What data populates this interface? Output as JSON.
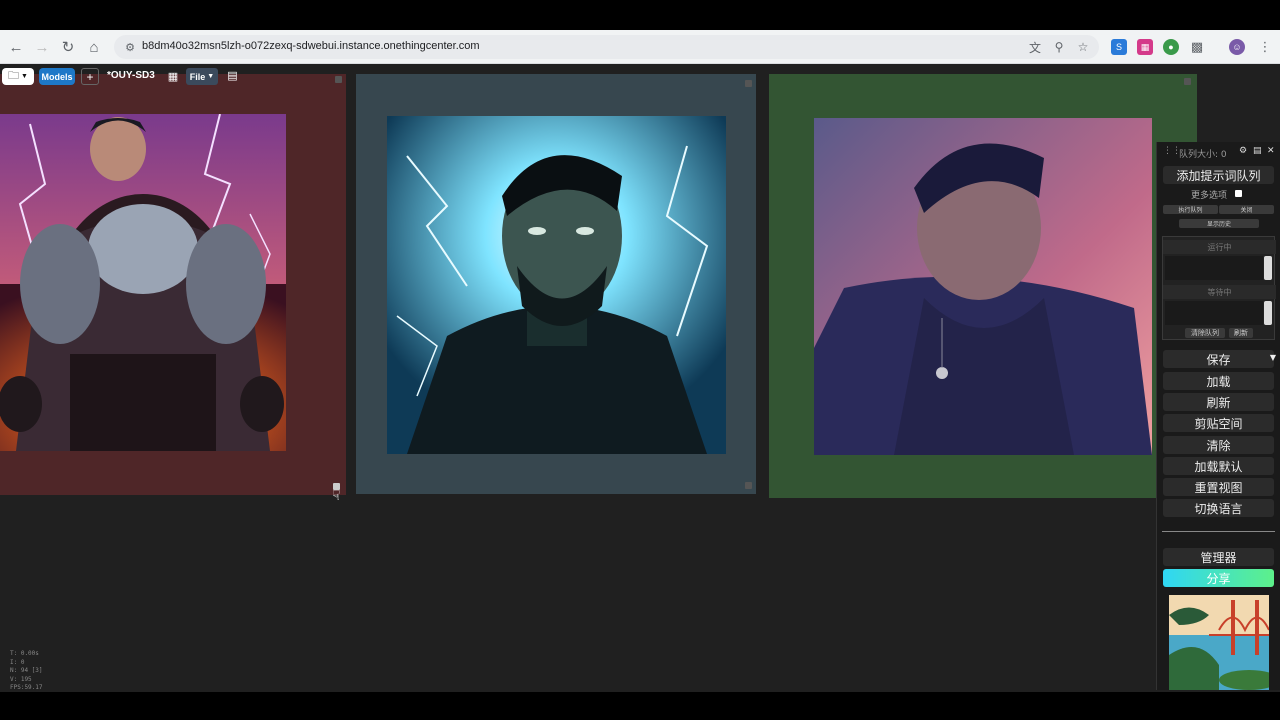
{
  "browser": {
    "url": "b8dm40o32msn5lzh-o072zexq-sdwebui.instance.onethingcenter.com"
  },
  "app_toolbar": {
    "models_label": "Models",
    "plus_label": "+",
    "workflow_title": "*OUY-SD3",
    "file_label": "File"
  },
  "sidebar": {
    "queue_size": "队列大小: 0",
    "add_queue": "添加提示词队列",
    "more_options": "更多选项",
    "run_queue": "执行队列",
    "close": "关闭",
    "show_history": "显示历史",
    "running": "运行中",
    "pending": "等待中",
    "clear_queue": "清除队列",
    "refresh_small": "刷新",
    "save": "保存",
    "load": "加载",
    "refresh": "刷新",
    "clipspace": "剪贴空间",
    "clear": "清除",
    "load_default": "加载默认",
    "reset_view": "重置视图",
    "switch_language": "切换语言",
    "manager": "管理器",
    "share": "分享"
  },
  "stats": {
    "t": "T: 0.00s",
    "i": "I: 0",
    "n": "N: 94 [3]",
    "v": "V: 195",
    "fps": "FPS:59.17"
  },
  "colors": {
    "group_1": "#4f2628",
    "group_2": "#37474f",
    "group_3": "#335533",
    "share_gradient_start": "#2fd6f4",
    "share_gradient_end": "#5df08a",
    "models_button": "#1e78c8"
  }
}
